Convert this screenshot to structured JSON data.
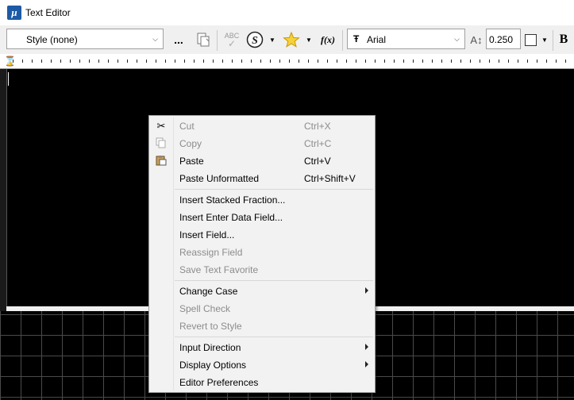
{
  "window": {
    "title": "Text Editor",
    "app_icon_glyph": "μ"
  },
  "toolbar": {
    "style_combo": "Style (none)",
    "more_label": "...",
    "font_combo": "Arial",
    "font_glyph": "Ŧ",
    "height_value": "0.250",
    "bold_label": "B",
    "spell_label": "ABC",
    "field_label": "f(x)",
    "icons": [
      "more-icon",
      "copy-format-icon",
      "spell-check-icon",
      "symbol-icon",
      "favorite-star-icon",
      "insert-field-icon",
      "font-icon",
      "text-height-icon",
      "color-swatch-icon",
      "bold-icon"
    ]
  },
  "context_menu": {
    "groups": [
      [
        {
          "label": "Cut",
          "shortcut": "Ctrl+X",
          "disabled": true,
          "icon": "scissors-icon"
        },
        {
          "label": "Copy",
          "shortcut": "Ctrl+C",
          "disabled": true,
          "icon": "copy-icon"
        },
        {
          "label": "Paste",
          "shortcut": "Ctrl+V",
          "disabled": false,
          "icon": "paste-icon"
        },
        {
          "label": "Paste Unformatted",
          "shortcut": "Ctrl+Shift+V",
          "disabled": false
        }
      ],
      [
        {
          "label": "Insert Stacked Fraction...",
          "disabled": false
        },
        {
          "label": "Insert Enter Data Field...",
          "disabled": false
        },
        {
          "label": "Insert Field...",
          "disabled": false,
          "highlighted": true
        },
        {
          "label": "Reassign Field",
          "disabled": true
        },
        {
          "label": "Save Text Favorite",
          "disabled": true
        }
      ],
      [
        {
          "label": "Change Case",
          "disabled": false,
          "submenu": true
        },
        {
          "label": "Spell Check",
          "disabled": true
        },
        {
          "label": "Revert to Style",
          "disabled": true
        }
      ],
      [
        {
          "label": "Input Direction",
          "disabled": false,
          "submenu": true
        },
        {
          "label": "Display Options",
          "disabled": false,
          "submenu": true
        },
        {
          "label": "Editor Preferences",
          "disabled": false
        }
      ]
    ],
    "highlight_color": "#fbfb8a"
  }
}
